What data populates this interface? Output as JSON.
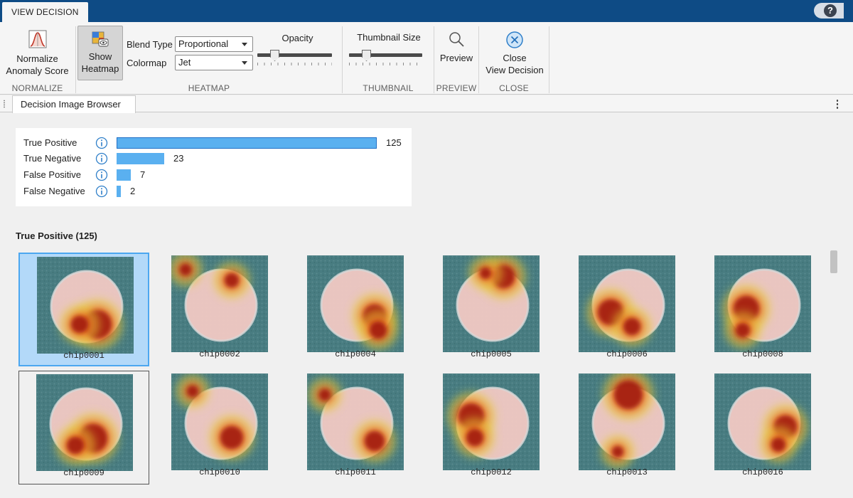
{
  "titlebar": {
    "tab_label": "VIEW DECISION",
    "help_label": "?"
  },
  "toolstrip": {
    "normalize": {
      "button_line1": "Normalize",
      "button_line2": "Anomaly Score",
      "section": "NORMALIZE"
    },
    "heatmap": {
      "show_line1": "Show",
      "show_line2": "Heatmap",
      "blend_label": "Blend Type",
      "blend_value": "Proportional",
      "colormap_label": "Colormap",
      "colormap_value": "Jet",
      "opacity_label": "Opacity",
      "opacity_level": 0.2,
      "section": "HEATMAP"
    },
    "thumbnail": {
      "size_label": "Thumbnail Size",
      "size_level": 0.2,
      "section": "THUMBNAIL"
    },
    "preview": {
      "button": "Preview",
      "section": "PREVIEW"
    },
    "close": {
      "line1": "Close",
      "line2": "View Decision",
      "section": "CLOSE"
    }
  },
  "doc_tab": {
    "label": "Decision Image Browser"
  },
  "summary": {
    "rows": [
      {
        "label": "True Positive",
        "count": 125,
        "value": "125"
      },
      {
        "label": "True Negative",
        "count": 23,
        "value": "23"
      },
      {
        "label": "False Positive",
        "count": 7,
        "value": "7"
      },
      {
        "label": "False Negative",
        "count": 2,
        "value": "2"
      }
    ]
  },
  "gallery": {
    "title": "True Positive (125)",
    "items": [
      {
        "name": "chip0001"
      },
      {
        "name": "chip0002"
      },
      {
        "name": "chip0004"
      },
      {
        "name": "chip0005"
      },
      {
        "name": "chip0006"
      },
      {
        "name": "chip0008"
      },
      {
        "name": "chip0009"
      },
      {
        "name": "chip0010"
      },
      {
        "name": "chip0011"
      },
      {
        "name": "chip0012"
      },
      {
        "name": "chip0013"
      },
      {
        "name": "chip0016"
      }
    ]
  },
  "colors": {
    "titlebar": "#0e4b85",
    "bar": "#5ab0f0",
    "selection": "#b3d9f9",
    "selection_border": "#4ca7f0"
  }
}
